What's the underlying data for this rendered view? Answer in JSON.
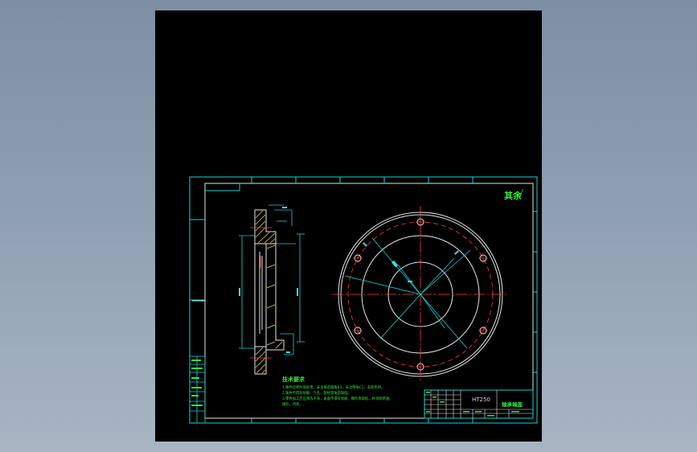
{
  "drawing": {
    "stamp": "其余",
    "material": "HT250",
    "part_title": "轴承端盖",
    "tech_title": "技术要求",
    "tech_notes": [
      "1.铸件应经时效处理，未注铸造圆角R3，未注倒角C1，去除毛刺。",
      "2.铸件不得有砂眼、气孔、裂纹等铸造缺陷。",
      "3.零件加工后应清洗干净，表面不得有划痕、擦伤等缺陷，并涂防锈油，",
      "  储存，待装。"
    ]
  },
  "colors": {
    "frame": "#19d2d2",
    "green_text": "#35e835",
    "red_line": "#ff3b3b",
    "white_line": "#e6e6e6",
    "hatch": "#e8d24a"
  }
}
